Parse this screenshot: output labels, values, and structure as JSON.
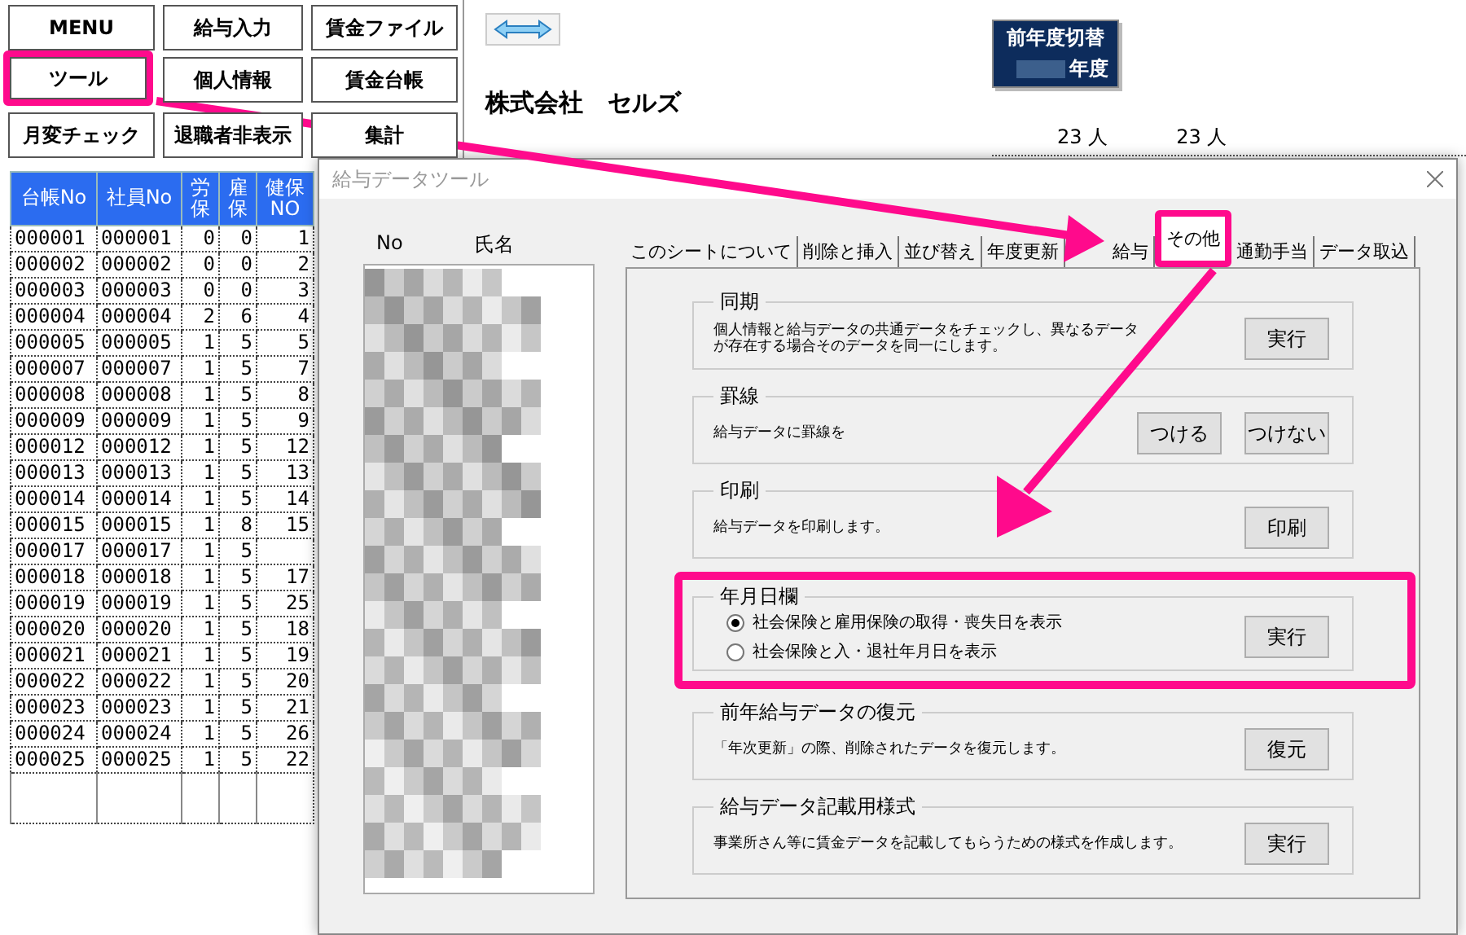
{
  "menu_buttons": [
    {
      "label": "MENU",
      "highlighted": false
    },
    {
      "label": "給与入力",
      "highlighted": false
    },
    {
      "label": "賃金ファイル",
      "highlighted": false
    },
    {
      "label": "ツール",
      "highlighted": true
    },
    {
      "label": "個人情報",
      "highlighted": false
    },
    {
      "label": "賃金台帳",
      "highlighted": false
    },
    {
      "label": "月変チェック",
      "highlighted": false
    },
    {
      "label": "退職者非表示",
      "highlighted": false
    },
    {
      "label": "集計",
      "highlighted": false
    }
  ],
  "sheet": {
    "company": "株式会社　セルズ",
    "year_switch": {
      "line1": "前年度切替",
      "line2": "年度"
    },
    "headcounts": [
      "23 人",
      "23 人"
    ]
  },
  "table": {
    "columns": [
      "台帳No",
      "社員No",
      "労保",
      "雇保",
      "健保NO"
    ],
    "rows": [
      [
        "000001",
        "000001",
        "0",
        "0",
        "1"
      ],
      [
        "000002",
        "000002",
        "0",
        "0",
        "2"
      ],
      [
        "000003",
        "000003",
        "0",
        "0",
        "3"
      ],
      [
        "000004",
        "000004",
        "2",
        "6",
        "4"
      ],
      [
        "000005",
        "000005",
        "1",
        "5",
        "5"
      ],
      [
        "000007",
        "000007",
        "1",
        "5",
        "7"
      ],
      [
        "000008",
        "000008",
        "1",
        "5",
        "8"
      ],
      [
        "000009",
        "000009",
        "1",
        "5",
        "9"
      ],
      [
        "000012",
        "000012",
        "1",
        "5",
        "12"
      ],
      [
        "000013",
        "000013",
        "1",
        "5",
        "13"
      ],
      [
        "000014",
        "000014",
        "1",
        "5",
        "14"
      ],
      [
        "000015",
        "000015",
        "1",
        "8",
        "15"
      ],
      [
        "000017",
        "000017",
        "1",
        "5",
        ""
      ],
      [
        "000018",
        "000018",
        "1",
        "5",
        "17"
      ],
      [
        "000019",
        "000019",
        "1",
        "5",
        "25"
      ],
      [
        "000020",
        "000020",
        "1",
        "5",
        "18"
      ],
      [
        "000021",
        "000021",
        "1",
        "5",
        "19"
      ],
      [
        "000022",
        "000022",
        "1",
        "5",
        "20"
      ],
      [
        "000023",
        "000023",
        "1",
        "5",
        "21"
      ],
      [
        "000024",
        "000024",
        "1",
        "5",
        "26"
      ],
      [
        "000025",
        "000025",
        "1",
        "5",
        "22"
      ]
    ]
  },
  "dialog": {
    "title": "給与データツール",
    "list_columns": [
      "No",
      "氏名"
    ],
    "tabs": [
      {
        "label": "このシートについて",
        "selected": false,
        "highlighted": false
      },
      {
        "label": "削除と挿入",
        "selected": false,
        "highlighted": false
      },
      {
        "label": "並び替え",
        "selected": false,
        "highlighted": false
      },
      {
        "label": "年度更新",
        "selected": false,
        "highlighted": false
      },
      {
        "label": "給与",
        "selected": false,
        "highlighted": false
      },
      {
        "label": "その他",
        "selected": true,
        "highlighted": true
      },
      {
        "label": "通勤手当",
        "selected": false,
        "highlighted": false
      },
      {
        "label": "データ取込",
        "selected": false,
        "highlighted": false
      }
    ],
    "groups": [
      {
        "title": "同期",
        "kind": "text",
        "highlighted": false,
        "lines": [
          "個人情報と給与データの共通データをチェックし、異なるデータ",
          "が存在する場合そのデータを同一にします。"
        ],
        "buttons": [
          "実行"
        ]
      },
      {
        "title": "罫線",
        "kind": "text",
        "highlighted": false,
        "lines": [
          "給与データに罫線を"
        ],
        "buttons": [
          "つける",
          "つけない"
        ]
      },
      {
        "title": "印刷",
        "kind": "text",
        "highlighted": false,
        "lines": [
          "給与データを印刷します。"
        ],
        "buttons": [
          "印刷"
        ]
      },
      {
        "title": "年月日欄",
        "kind": "radio",
        "highlighted": true,
        "options": [
          {
            "label": "社会保険と雇用保険の取得・喪失日を表示",
            "selected": true
          },
          {
            "label": "社会保険と入・退社年月日を表示",
            "selected": false
          }
        ],
        "buttons": [
          "実行"
        ]
      },
      {
        "title": "前年給与データの復元",
        "kind": "text",
        "highlighted": false,
        "lines": [
          "「年次更新」の際、削除されたデータを復元します。"
        ],
        "buttons": [
          "復元"
        ]
      },
      {
        "title": "給与データ記載用様式",
        "kind": "text",
        "highlighted": false,
        "lines": [
          "事業所さん等に賃金データを記載してもらうための様式を作成します。"
        ],
        "buttons": [
          "実行"
        ]
      }
    ]
  }
}
